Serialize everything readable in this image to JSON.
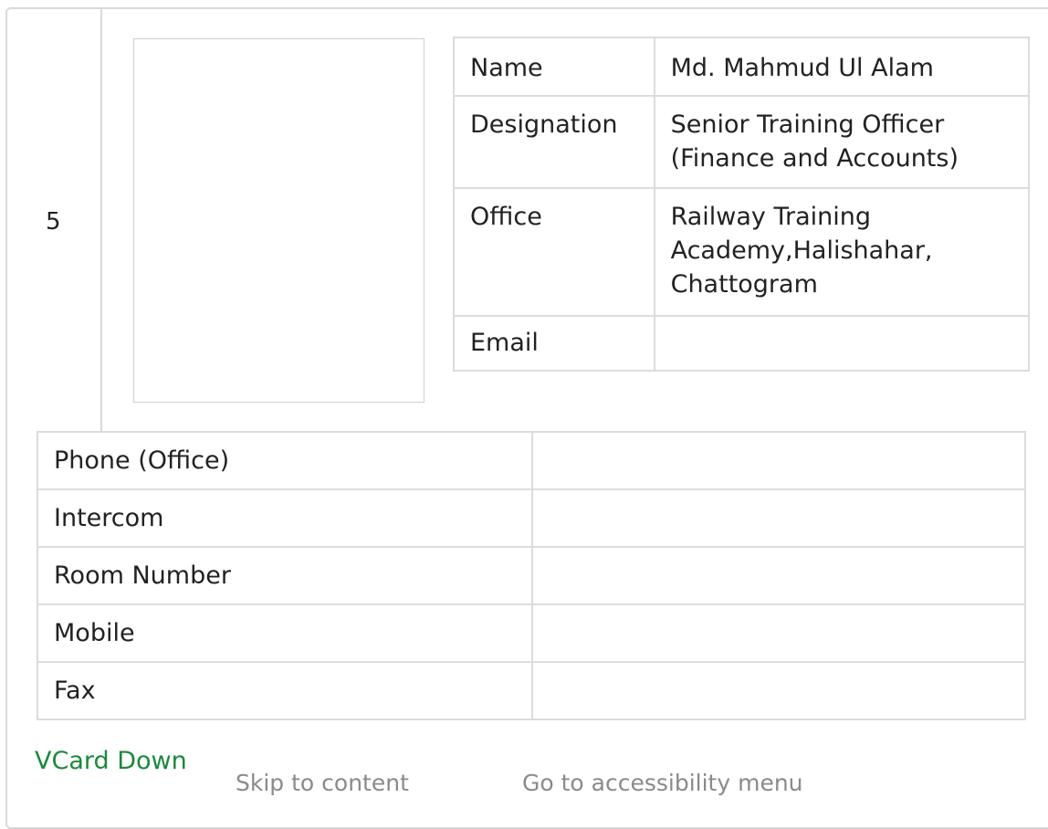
{
  "entry": {
    "serial": "5",
    "info_rows": [
      {
        "label": "Name",
        "value": "Md. Mahmud Ul Alam"
      },
      {
        "label": "Designation",
        "value": "Senior Training Officer (Finance and Accounts)"
      },
      {
        "label": "Office",
        "value": "Railway Training Academy,Halishahar, Chattogram"
      },
      {
        "label": "Email",
        "value": ""
      }
    ],
    "contact_rows": [
      {
        "label": "Phone (Office)",
        "value": ""
      },
      {
        "label": "Intercom",
        "value": ""
      },
      {
        "label": "Room Number",
        "value": ""
      },
      {
        "label": "Mobile",
        "value": ""
      },
      {
        "label": "Fax",
        "value": ""
      }
    ],
    "vcard_label": "VCard Down"
  },
  "skip_links": {
    "skip_to_content": "Skip to content",
    "accessibility_menu": "Go to accessibility menu"
  }
}
